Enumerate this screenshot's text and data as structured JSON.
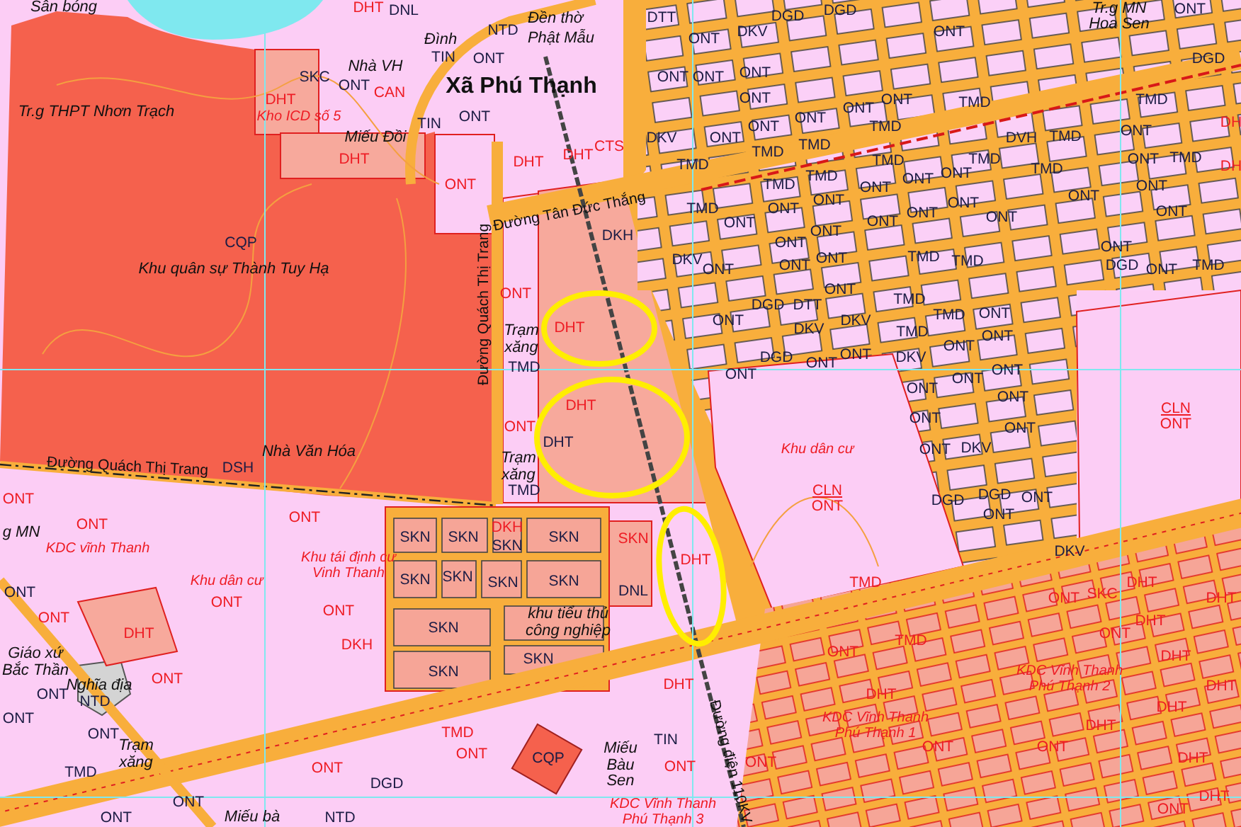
{
  "map": {
    "labels": [
      {
        "text": "Sân bóng",
        "kind": "place"
      },
      {
        "text": "DHT",
        "kind": "code-red"
      },
      {
        "text": "DNL",
        "kind": "code"
      },
      {
        "text": "Đền thờ",
        "kind": "place"
      },
      {
        "text": "Phật Mẫu",
        "kind": "place"
      },
      {
        "text": "NTD",
        "kind": "code"
      },
      {
        "text": "Đình",
        "kind": "place"
      },
      {
        "text": "TIN",
        "kind": "code"
      },
      {
        "text": "ONT",
        "kind": "code"
      },
      {
        "text": "SKC",
        "kind": "code"
      },
      {
        "text": "Nhà VH",
        "kind": "place"
      },
      {
        "text": "ONT",
        "kind": "code"
      },
      {
        "text": "CAN",
        "kind": "code-red"
      },
      {
        "text": "Xã Phú Thạnh",
        "kind": "commune"
      },
      {
        "text": "DHT",
        "kind": "code-red"
      },
      {
        "text": "Tr.g THPT Nhơn Trạch",
        "kind": "place"
      },
      {
        "text": "Kho ICD số 5",
        "kind": "place-red"
      },
      {
        "text": "TIN",
        "kind": "code"
      },
      {
        "text": "ONT",
        "kind": "code"
      },
      {
        "text": "Miếu Đồi",
        "kind": "place"
      },
      {
        "text": "DHT",
        "kind": "code-red"
      },
      {
        "text": "ONT",
        "kind": "code-red"
      },
      {
        "text": "DHT",
        "kind": "code-red"
      },
      {
        "text": "DHT",
        "kind": "code-red"
      },
      {
        "text": "CTS",
        "kind": "code-red"
      },
      {
        "text": "Đường Tân Đức Thắng",
        "kind": "road"
      },
      {
        "text": "DKH",
        "kind": "code"
      },
      {
        "text": "CQP",
        "kind": "code"
      },
      {
        "text": "Khu quân sự Thành Tuy Hạ",
        "kind": "place"
      },
      {
        "text": "Đường Quách Thị Trang",
        "kind": "road"
      },
      {
        "text": "ONT",
        "kind": "code-red"
      },
      {
        "text": "Trạm xăng",
        "kind": "place"
      },
      {
        "text": "TMD",
        "kind": "code"
      },
      {
        "text": "DHT",
        "kind": "code-red"
      },
      {
        "text": "DHT",
        "kind": "code-red"
      },
      {
        "text": "DHT",
        "kind": "code"
      },
      {
        "text": "ONT",
        "kind": "code-red"
      },
      {
        "text": "Trạm xăng",
        "kind": "place"
      },
      {
        "text": "TMD",
        "kind": "code"
      },
      {
        "text": "Đường Quách Thị Trang",
        "kind": "road"
      },
      {
        "text": "DSH",
        "kind": "code"
      },
      {
        "text": "Nhà Văn Hóa",
        "kind": "place"
      },
      {
        "text": "ONT",
        "kind": "code-red"
      },
      {
        "text": "ONT",
        "kind": "code-red"
      },
      {
        "text": "ONT",
        "kind": "code-red"
      },
      {
        "text": "g MN",
        "kind": "place"
      },
      {
        "text": "KDC vĩnh Thanh",
        "kind": "place-red"
      },
      {
        "text": "SKN",
        "kind": "code"
      },
      {
        "text": "SKN",
        "kind": "code"
      },
      {
        "text": "DKH",
        "kind": "code-red"
      },
      {
        "text": "SKN",
        "kind": "code"
      },
      {
        "text": "SKN",
        "kind": "code"
      },
      {
        "text": "SKN",
        "kind": "code"
      },
      {
        "text": "SKN",
        "kind": "code"
      },
      {
        "text": "SKN",
        "kind": "code"
      },
      {
        "text": "SKN",
        "kind": "code"
      },
      {
        "text": "SKN",
        "kind": "code"
      },
      {
        "text": "khu tiểu thủ công nghiệp",
        "kind": "place"
      },
      {
        "text": "SKN",
        "kind": "code"
      },
      {
        "text": "SKN",
        "kind": "code"
      },
      {
        "text": "SKN",
        "kind": "code-red"
      },
      {
        "text": "DNL",
        "kind": "code"
      },
      {
        "text": "DHT",
        "kind": "code-red"
      },
      {
        "text": "Khu dân cư",
        "kind": "place-red"
      },
      {
        "text": "Khu tái định cư Vinh Thanh",
        "kind": "place-red"
      },
      {
        "text": "ONT",
        "kind": "code-red"
      },
      {
        "text": "ONT",
        "kind": "code-red"
      },
      {
        "text": "DKH",
        "kind": "code-red"
      },
      {
        "text": "DHT",
        "kind": "code-red"
      },
      {
        "text": "ONT",
        "kind": "code"
      },
      {
        "text": "ONT",
        "kind": "code-red"
      },
      {
        "text": "Giáo xứ Bắc Thần",
        "kind": "place"
      },
      {
        "text": "Nghĩa địa",
        "kind": "place"
      },
      {
        "text": "NTD",
        "kind": "code"
      },
      {
        "text": "ONT",
        "kind": "code"
      },
      {
        "text": "ONT",
        "kind": "code-red"
      },
      {
        "text": "ONT",
        "kind": "code"
      },
      {
        "text": "ONT",
        "kind": "code"
      },
      {
        "text": "Trạm xăng",
        "kind": "place"
      },
      {
        "text": "TMD",
        "kind": "code"
      },
      {
        "text": "ONT",
        "kind": "code"
      },
      {
        "text": "ONT",
        "kind": "code"
      },
      {
        "text": "Miếu bà",
        "kind": "place"
      },
      {
        "text": "NTD",
        "kind": "code"
      },
      {
        "text": "DGD",
        "kind": "code"
      },
      {
        "text": "ONT",
        "kind": "code-red"
      },
      {
        "text": "TMD",
        "kind": "code-red"
      },
      {
        "text": "ONT",
        "kind": "code-red"
      },
      {
        "text": "CQP",
        "kind": "code"
      },
      {
        "text": "Miếu Bàu Sen",
        "kind": "place"
      },
      {
        "text": "TIN",
        "kind": "code"
      },
      {
        "text": "ONT",
        "kind": "code-red"
      },
      {
        "text": "KDC Vĩnh Thanh Phú Thạnh 3",
        "kind": "place-red"
      },
      {
        "text": "Đường điện 110KV",
        "kind": "road"
      },
      {
        "text": "DHT",
        "kind": "code-red"
      },
      {
        "text": "ONT",
        "kind": "code-red"
      },
      {
        "text": "TMD",
        "kind": "code-red"
      },
      {
        "text": "TMD",
        "kind": "code-red"
      },
      {
        "text": "ONT",
        "kind": "code-red"
      },
      {
        "text": "DHT",
        "kind": "code-red"
      },
      {
        "text": "KDC Vĩnh Thanh Phú Thạnh 1",
        "kind": "place-red"
      },
      {
        "text": "ONT",
        "kind": "code-red"
      },
      {
        "text": "ONT",
        "kind": "code-red"
      },
      {
        "text": "SKC",
        "kind": "code-red"
      },
      {
        "text": "DHT",
        "kind": "code-red"
      },
      {
        "text": "ONT",
        "kind": "code-red"
      },
      {
        "text": "DHT",
        "kind": "code-red"
      },
      {
        "text": "KDC Vĩnh Thanh Phú Thạnh 2",
        "kind": "place-red"
      },
      {
        "text": "DHT",
        "kind": "code-red"
      },
      {
        "text": "ONT",
        "kind": "code-red"
      },
      {
        "text": "DHT",
        "kind": "code-red"
      },
      {
        "text": "DHT",
        "kind": "code-red"
      },
      {
        "text": "DHT",
        "kind": "code-red"
      },
      {
        "text": "DHT",
        "kind": "code-red"
      },
      {
        "text": "DHT",
        "kind": "code-red"
      },
      {
        "text": "DHT",
        "kind": "code-red"
      },
      {
        "text": "ONT",
        "kind": "code-red"
      },
      {
        "text": "DKV",
        "kind": "code"
      },
      {
        "text": "DTT",
        "kind": "code"
      },
      {
        "text": "DGD",
        "kind": "code"
      },
      {
        "text": "DKV",
        "kind": "code"
      },
      {
        "text": "DGD",
        "kind": "code"
      },
      {
        "text": "ONT",
        "kind": "code"
      },
      {
        "text": "ONT",
        "kind": "code"
      },
      {
        "text": "Tr.g MN",
        "kind": "place"
      },
      {
        "text": "Hoa Sen",
        "kind": "place"
      },
      {
        "text": "ONT",
        "kind": "code"
      },
      {
        "text": "DGD",
        "kind": "code"
      },
      {
        "text": "ONT",
        "kind": "code"
      },
      {
        "text": "ONT",
        "kind": "code"
      },
      {
        "text": "ONT",
        "kind": "code"
      },
      {
        "text": "ONT",
        "kind": "code"
      },
      {
        "text": "ONT",
        "kind": "code"
      },
      {
        "text": "ONT",
        "kind": "code"
      },
      {
        "text": "ONT",
        "kind": "code"
      },
      {
        "text": "ONT",
        "kind": "code"
      },
      {
        "text": "DKV",
        "kind": "code"
      },
      {
        "text": "ONT",
        "kind": "code"
      },
      {
        "text": "TMD",
        "kind": "code"
      },
      {
        "text": "TMD",
        "kind": "code"
      },
      {
        "text": "TMD",
        "kind": "code"
      },
      {
        "text": "TMD",
        "kind": "code"
      },
      {
        "text": "TMD",
        "kind": "code"
      },
      {
        "text": "TMD",
        "kind": "code"
      },
      {
        "text": "TMD",
        "kind": "code"
      },
      {
        "text": "ONT",
        "kind": "code"
      },
      {
        "text": "ONT",
        "kind": "code"
      },
      {
        "text": "TMD",
        "kind": "code"
      },
      {
        "text": "ONT",
        "kind": "code"
      },
      {
        "text": "ONT",
        "kind": "code"
      },
      {
        "text": "ONT",
        "kind": "code"
      },
      {
        "text": "ONT",
        "kind": "code"
      },
      {
        "text": "ONT",
        "kind": "code"
      },
      {
        "text": "ONT",
        "kind": "code"
      },
      {
        "text": "ONT",
        "kind": "code"
      },
      {
        "text": "ONT",
        "kind": "code"
      },
      {
        "text": "DKV",
        "kind": "code"
      },
      {
        "text": "ONT",
        "kind": "code"
      },
      {
        "text": "TMD",
        "kind": "code"
      },
      {
        "text": "TMD",
        "kind": "code"
      },
      {
        "text": "ONT",
        "kind": "code"
      },
      {
        "text": "ONT",
        "kind": "code"
      },
      {
        "text": "ONT",
        "kind": "code"
      },
      {
        "text": "ONT",
        "kind": "code"
      },
      {
        "text": "TMD",
        "kind": "code"
      },
      {
        "text": "DVH",
        "kind": "code"
      },
      {
        "text": "TMD",
        "kind": "code"
      },
      {
        "text": "TMD",
        "kind": "code"
      },
      {
        "text": "TMD",
        "kind": "code"
      },
      {
        "text": "ONT",
        "kind": "code"
      },
      {
        "text": "TMD",
        "kind": "code"
      },
      {
        "text": "ONT",
        "kind": "code"
      },
      {
        "text": "ONT",
        "kind": "code"
      },
      {
        "text": "ONT",
        "kind": "code"
      },
      {
        "text": "TMD",
        "kind": "code"
      },
      {
        "text": "ONT",
        "kind": "code"
      },
      {
        "text": "ONT",
        "kind": "code"
      },
      {
        "text": "DGD",
        "kind": "code"
      },
      {
        "text": "ONT",
        "kind": "code"
      },
      {
        "text": "TMD",
        "kind": "code"
      },
      {
        "text": "DH",
        "kind": "code-red"
      },
      {
        "text": "DH",
        "kind": "code-red"
      },
      {
        "text": "ONT",
        "kind": "code"
      },
      {
        "text": "DGD",
        "kind": "code"
      },
      {
        "text": "DTT",
        "kind": "code"
      },
      {
        "text": "ONT",
        "kind": "code"
      },
      {
        "text": "TMD",
        "kind": "code"
      },
      {
        "text": "TMD",
        "kind": "code"
      },
      {
        "text": "ONT",
        "kind": "code"
      },
      {
        "text": "DKV",
        "kind": "code"
      },
      {
        "text": "DKV",
        "kind": "code"
      },
      {
        "text": "TMD",
        "kind": "code"
      },
      {
        "text": "ONT",
        "kind": "code"
      },
      {
        "text": "ONT",
        "kind": "code"
      },
      {
        "text": "ONT",
        "kind": "code"
      },
      {
        "text": "DGD",
        "kind": "code"
      },
      {
        "text": "ONT",
        "kind": "code"
      },
      {
        "text": "ONT",
        "kind": "code"
      },
      {
        "text": "DKV",
        "kind": "code"
      },
      {
        "text": "ONT",
        "kind": "code"
      },
      {
        "text": "ONT",
        "kind": "code"
      },
      {
        "text": "ONT",
        "kind": "code"
      },
      {
        "text": "ONT",
        "kind": "code"
      },
      {
        "text": "ONT",
        "kind": "code"
      },
      {
        "text": "ONT",
        "kind": "code"
      },
      {
        "text": "ONT",
        "kind": "code"
      },
      {
        "text": "DKV",
        "kind": "code"
      },
      {
        "text": "DGD",
        "kind": "code"
      },
      {
        "text": "DGD",
        "kind": "code"
      },
      {
        "text": "ONT",
        "kind": "code"
      },
      {
        "text": "ONT",
        "kind": "code"
      },
      {
        "text": "Khu dân cư",
        "kind": "place-red"
      },
      {
        "text": "CLN",
        "kind": "code-over"
      },
      {
        "text": "ONT",
        "kind": "code-red"
      },
      {
        "text": "CLN",
        "kind": "code-over"
      },
      {
        "text": "ONT",
        "kind": "code-red"
      }
    ]
  }
}
